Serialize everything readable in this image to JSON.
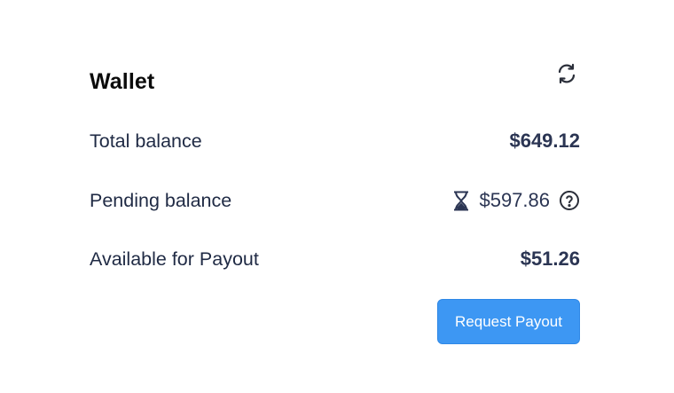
{
  "wallet": {
    "title": "Wallet",
    "refresh_icon": "refresh-icon"
  },
  "balances": {
    "total": {
      "label": "Total balance",
      "value": "$649.12"
    },
    "pending": {
      "label": "Pending balance",
      "value": "$597.86",
      "status_icon": "hourglass-icon",
      "info_icon": "help-circle-icon"
    },
    "available": {
      "label": "Available for Payout",
      "value": "$51.26"
    }
  },
  "actions": {
    "request_payout_label": "Request Payout"
  },
  "colors": {
    "accent": "#3d97f3",
    "text": "#1f2a44",
    "title": "#0b0b0b"
  }
}
